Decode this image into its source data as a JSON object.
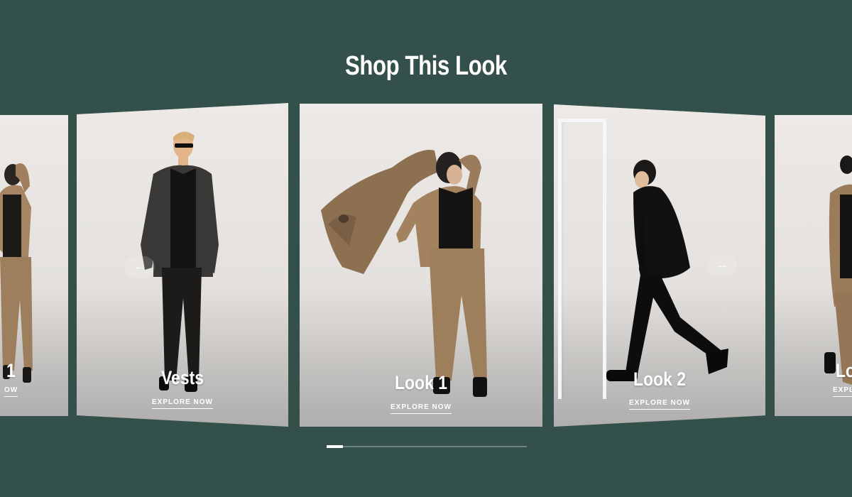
{
  "section": {
    "title": "Shop This Look"
  },
  "carousel": {
    "progress": 0.08,
    "cards": [
      {
        "label": "1",
        "cta": "OW"
      },
      {
        "label": "Vests",
        "cta": "EXPLORE NOW"
      },
      {
        "label": "Look 1",
        "cta": "EXPLORE NOW"
      },
      {
        "label": "Look 2",
        "cta": "EXPLORE NOW"
      },
      {
        "label": "Loo",
        "cta": "EXPLO"
      }
    ],
    "prev_icon": "arrow-left-icon",
    "next_icon": "arrow-right-icon"
  },
  "colors": {
    "background": "#34504a",
    "text": "#ffffff",
    "card_bg": "#e8e5e2"
  }
}
